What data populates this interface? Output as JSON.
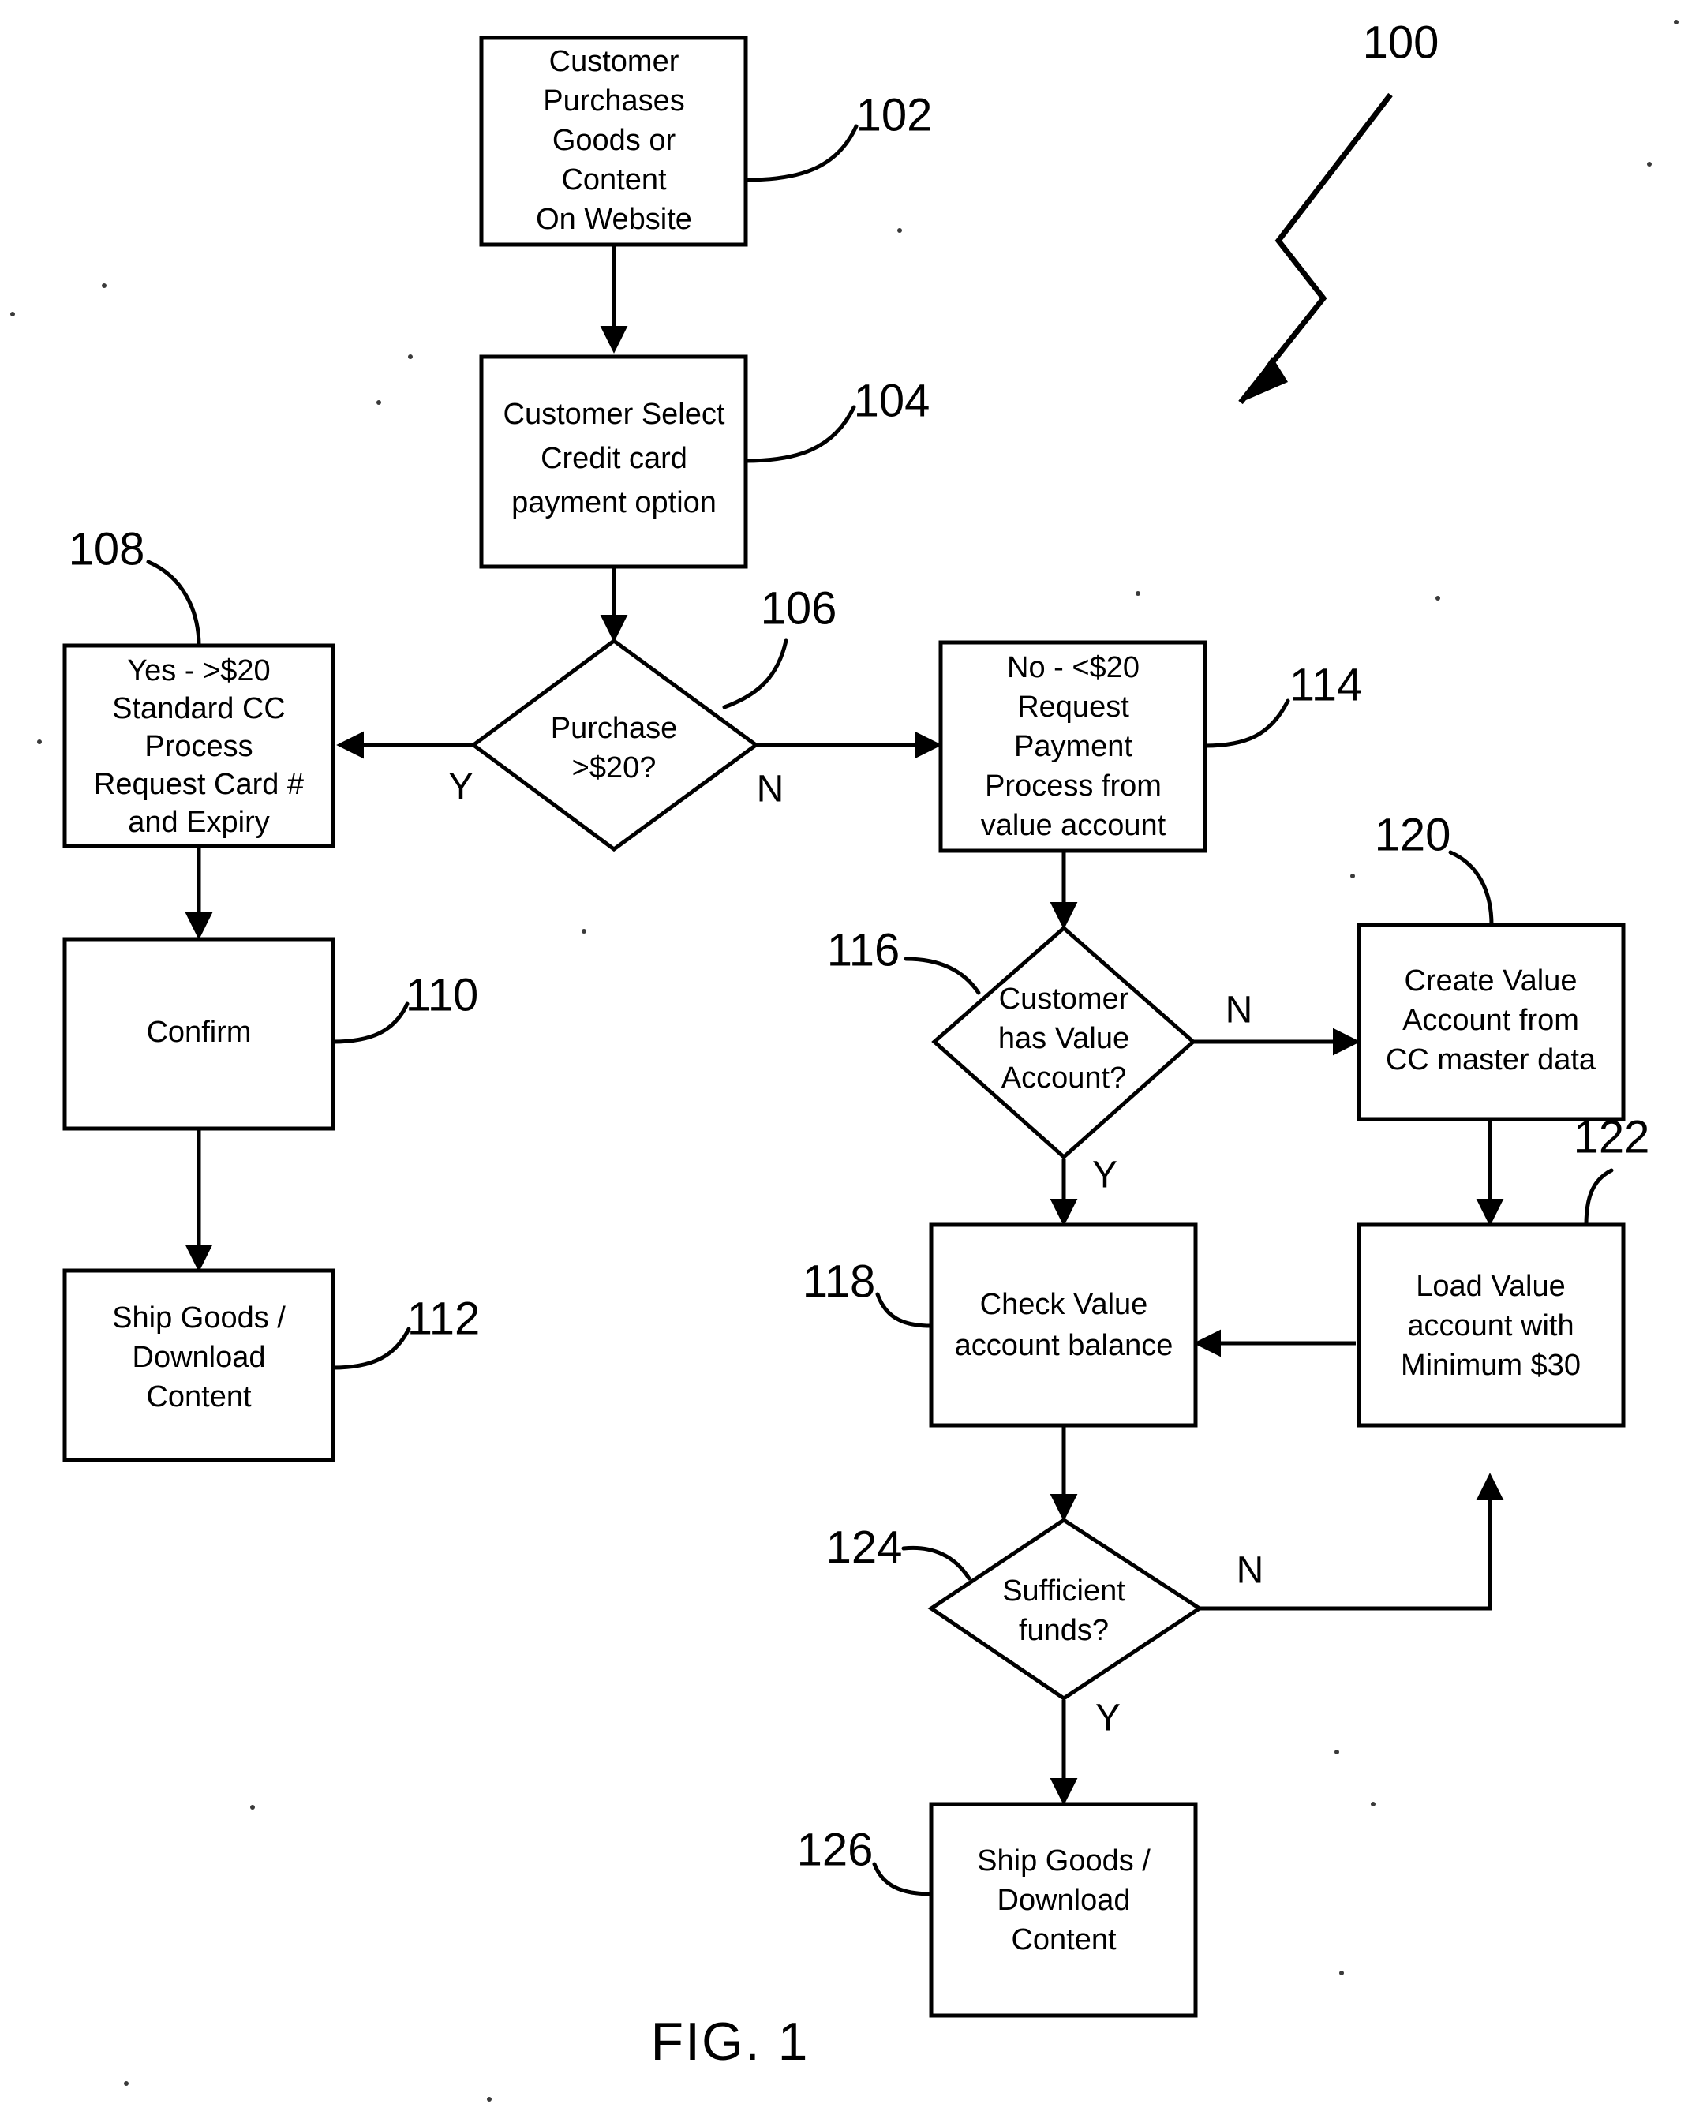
{
  "figure": {
    "caption": "FIG. 1",
    "overall_ref": "100"
  },
  "nodes": [
    {
      "ref": "102",
      "shape": "box",
      "name": "customer-purchases-goods",
      "lines": [
        "Customer",
        "Purchases",
        "Goods or",
        "Content",
        "On Website"
      ]
    },
    {
      "ref": "104",
      "shape": "box",
      "name": "customer-select-credit-card",
      "lines": [
        "Customer Select",
        "Credit card",
        "payment option"
      ]
    },
    {
      "ref": "106",
      "shape": "diamond",
      "name": "purchase-over-20-decision",
      "lines": [
        "Purchase",
        ">$20?"
      ]
    },
    {
      "ref": "108",
      "shape": "box",
      "name": "standard-cc-process",
      "lines": [
        "Yes - >$20",
        "Standard CC",
        "Process",
        "Request Card #",
        "and Expiry"
      ]
    },
    {
      "ref": "110",
      "shape": "box",
      "name": "confirm",
      "lines": [
        "Confirm"
      ]
    },
    {
      "ref": "112",
      "shape": "box",
      "name": "ship-goods-download-content-cc",
      "lines": [
        "Ship Goods /",
        "Download",
        "Content"
      ]
    },
    {
      "ref": "114",
      "shape": "box",
      "name": "request-payment-from-value-account",
      "lines": [
        "No - <$20",
        "Request",
        "Payment",
        "Process from",
        "value account"
      ]
    },
    {
      "ref": "116",
      "shape": "diamond",
      "name": "customer-has-value-account-decision",
      "lines": [
        "Customer",
        "has Value",
        "Account?"
      ]
    },
    {
      "ref": "118",
      "shape": "box",
      "name": "check-value-account-balance",
      "lines": [
        "Check Value",
        "account balance"
      ]
    },
    {
      "ref": "120",
      "shape": "box",
      "name": "create-value-account",
      "lines": [
        "Create Value",
        "Account from",
        "CC master data"
      ]
    },
    {
      "ref": "122",
      "shape": "box",
      "name": "load-value-account",
      "lines": [
        "Load Value",
        "account with",
        "Minimum $30"
      ]
    },
    {
      "ref": "124",
      "shape": "diamond",
      "name": "sufficient-funds-decision",
      "lines": [
        "Sufficient",
        "funds?"
      ]
    },
    {
      "ref": "126",
      "shape": "box",
      "name": "ship-goods-download-content-value",
      "lines": [
        "Ship Goods /",
        "Download",
        "Content"
      ]
    }
  ],
  "branch_labels": {
    "purchase_yes": "Y",
    "purchase_no": "N",
    "has_value_account_no": "N",
    "has_value_account_yes": "Y",
    "sufficient_funds_no": "N",
    "sufficient_funds_yes": "Y"
  },
  "colors": {
    "ink": "#000000",
    "paper": "#ffffff"
  }
}
